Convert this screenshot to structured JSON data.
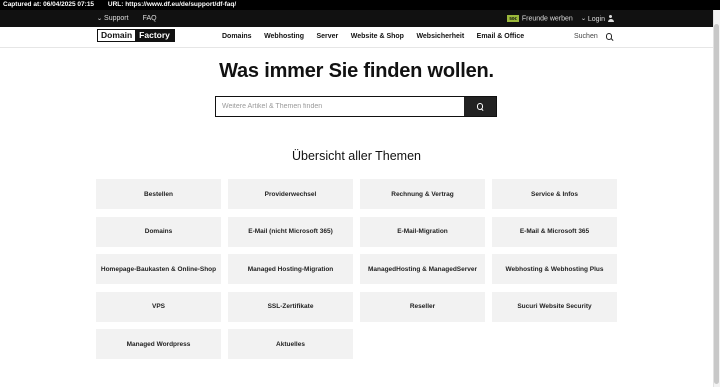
{
  "capture": {
    "captured": "Captured at: 06/04/2025 07:15",
    "url": "URL: https://www.df.eu/de/support/df-faq/"
  },
  "topbar": {
    "support_label": "Support",
    "faq_label": "FAQ",
    "badge_label": "50€",
    "refer_label": "Freunde werben",
    "login_label": "Login"
  },
  "logo": {
    "part1": "Domain",
    "part2": "Factory"
  },
  "nav": {
    "items": [
      "Domains",
      "Webhosting",
      "Server",
      "Website & Shop",
      "Websicherheit",
      "Email & Office"
    ],
    "search_label": "Suchen"
  },
  "hero": {
    "title": "Was immer Sie finden wollen.",
    "search_placeholder": "Weitere Artikel & Themen finden"
  },
  "topics": {
    "title": "Übersicht aller Themen",
    "items": [
      "Bestellen",
      "Providerwechsel",
      "Rechnung & Vertrag",
      "Service & Infos",
      "Domains",
      "E-Mail (nicht Microsoft 365)",
      "E-Mail-Migration",
      "E-Mail & Microsoft 365",
      "Homepage-Baukasten & Online-Shop",
      "Managed Hosting-Migration",
      "ManagedHosting & ManagedServer",
      "Webhosting & Webhosting Plus",
      "VPS",
      "SSL-Zertifikate",
      "Reseller",
      "Sucuri Website Security",
      "Managed Wordpress",
      "Aktuelles"
    ]
  },
  "colors": {
    "accent_badge": "#9bb83b",
    "dark": "#111111",
    "tile": "#f2f2f2"
  }
}
